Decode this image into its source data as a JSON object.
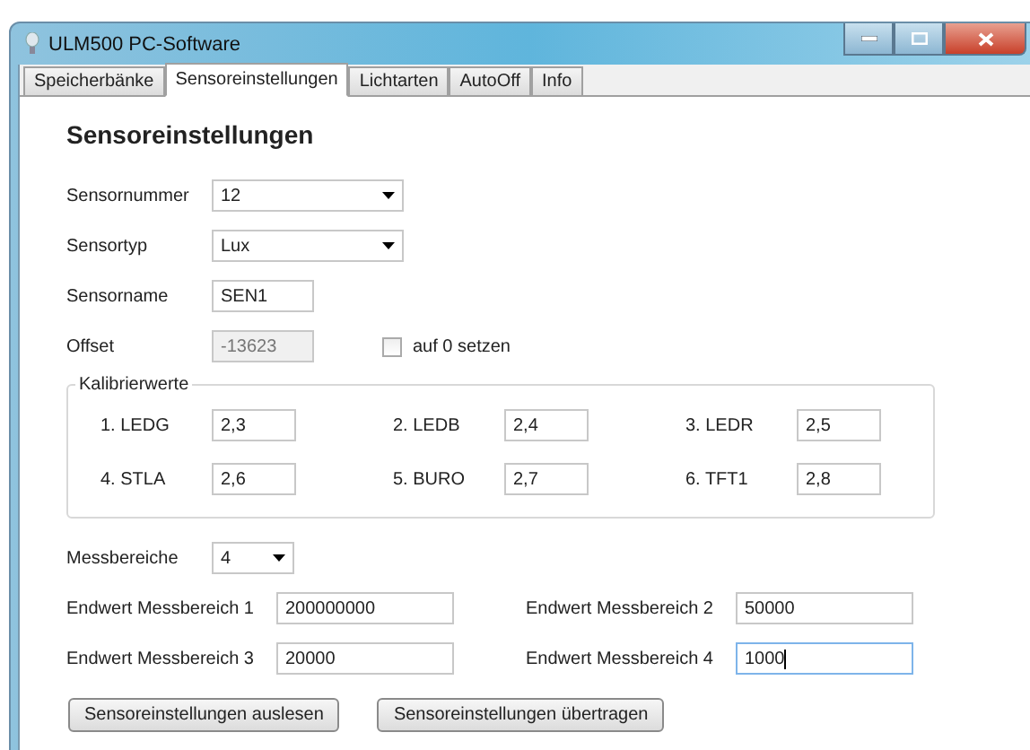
{
  "window": {
    "title": "ULM500 PC-Software"
  },
  "tabs": [
    {
      "label": "Speicherbänke",
      "selected": false
    },
    {
      "label": "Sensoreinstellungen",
      "selected": true
    },
    {
      "label": "Lichtarten",
      "selected": false
    },
    {
      "label": "AutoOff",
      "selected": false
    },
    {
      "label": "Info",
      "selected": false
    }
  ],
  "heading": "Sensoreinstellungen",
  "fields": [
    {
      "kind": "dropdown",
      "label": "Sensornummer",
      "value": "12",
      "disabled": false
    },
    {
      "kind": "dropdown",
      "label": "Sensortyp",
      "value": "Lux",
      "disabled": false
    },
    {
      "kind": "text",
      "label": "Sensorname",
      "value": "SEN1",
      "disabled": false
    },
    {
      "kind": "text",
      "label": "Offset",
      "value": "-13623",
      "disabled": true,
      "checkbox": {
        "label": "auf 0 setzen",
        "checked": false
      }
    }
  ],
  "calibration": {
    "title": "Kalibrierwerte",
    "items": [
      {
        "label": "1. LEDG",
        "value": "2,3"
      },
      {
        "label": "2. LEDB",
        "value": "2,4"
      },
      {
        "label": "3. LEDR",
        "value": "2,5"
      },
      {
        "label": "4. STLA",
        "value": "2,6"
      },
      {
        "label": "5. BURO",
        "value": "2,7"
      },
      {
        "label": "6. TFT1",
        "value": "2,8"
      }
    ]
  },
  "ranges": {
    "label": "Messbereiche",
    "value": "4"
  },
  "end_values": [
    {
      "label": "Endwert Messbereich 1",
      "value": "200000000",
      "focused": false
    },
    {
      "label": "Endwert Messbereich 2",
      "value": "50000",
      "focused": false
    },
    {
      "label": "Endwert Messbereich 3",
      "value": "20000",
      "focused": false
    },
    {
      "label": "Endwert Messbereich 4",
      "value": "1000",
      "focused": true
    }
  ],
  "buttons": [
    "Sensoreinstellungen auslesen",
    "Sensoreinstellungen übertragen"
  ]
}
